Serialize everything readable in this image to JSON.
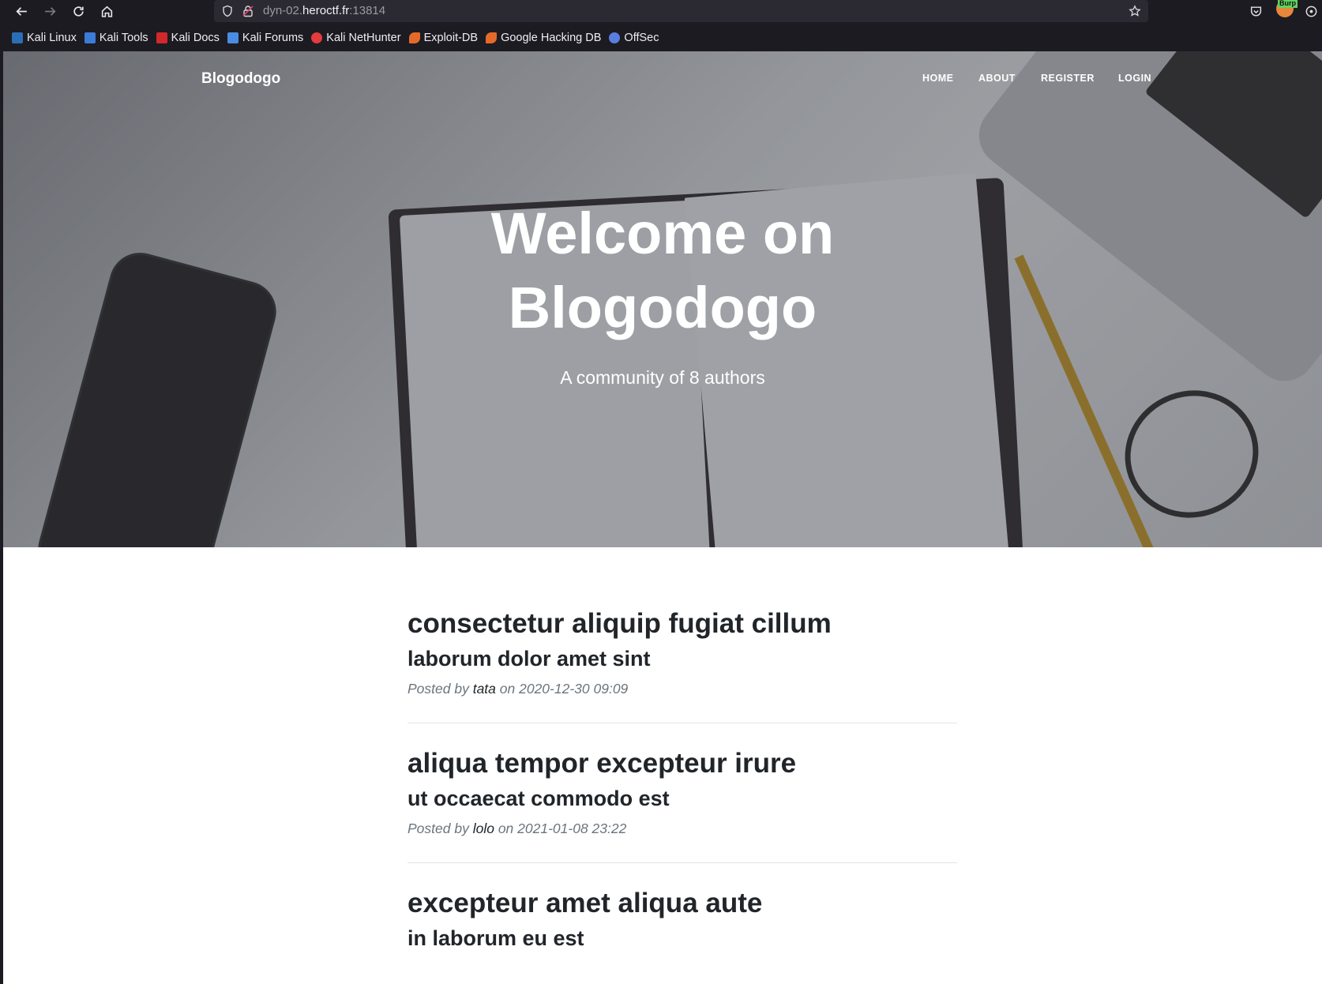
{
  "browser": {
    "url_prefix": "dyn-02.",
    "url_host": "heroctf.fr",
    "url_port": ":13814",
    "burp_badge": "Burp",
    "bookmarks": [
      {
        "label": "Kali Linux",
        "color": "#2a6fb5"
      },
      {
        "label": "Kali Tools",
        "color": "#3d7bd9"
      },
      {
        "label": "Kali Docs",
        "color": "#d0282b"
      },
      {
        "label": "Kali Forums",
        "color": "#4a8de0"
      },
      {
        "label": "Kali NetHunter",
        "color": "#e23c3c"
      },
      {
        "label": "Exploit-DB",
        "color": "#e56a2a"
      },
      {
        "label": "Google Hacking DB",
        "color": "#e56a2a"
      },
      {
        "label": "OffSec",
        "color": "#5a7ee0"
      }
    ]
  },
  "site": {
    "brand": "Blogodogo",
    "nav": {
      "home": "HOME",
      "about": "ABOUT",
      "register": "REGISTER",
      "login": "LOGIN"
    },
    "hero": {
      "title_line1": "Welcome on",
      "title_line2": "Blogodogo",
      "subtitle": "A community of 8 authors"
    }
  },
  "posts": [
    {
      "title": "consectetur aliquip fugiat cillum",
      "subtitle": "laborum dolor amet sint",
      "posted_by": "Posted by",
      "author": "tata",
      "on_date": "on 2020-12-30 09:09"
    },
    {
      "title": "aliqua tempor excepteur irure",
      "subtitle": "ut occaecat commodo est",
      "posted_by": "Posted by",
      "author": "lolo",
      "on_date": "on 2021-01-08 23:22"
    },
    {
      "title": "excepteur amet aliqua aute",
      "subtitle": "in laborum eu est"
    }
  ]
}
